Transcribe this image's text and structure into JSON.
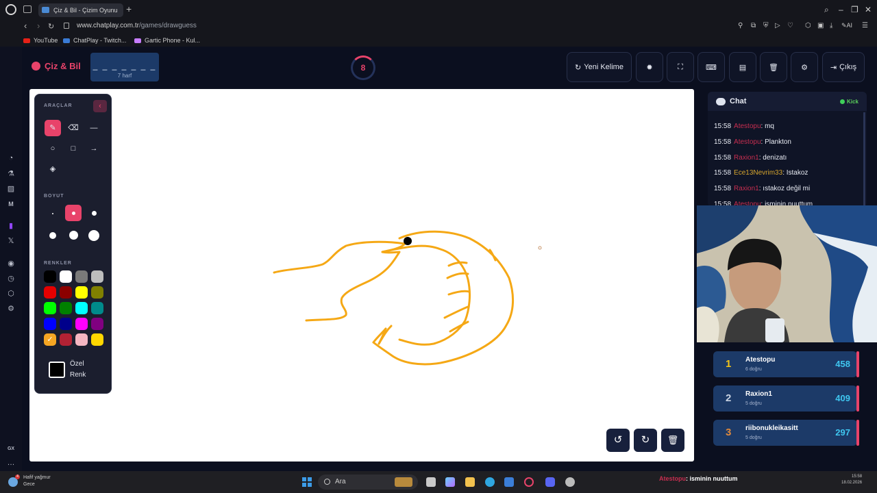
{
  "browser": {
    "tab_title": "Çiz & Bil - Çizim Oyunu",
    "url_host": "www.chatplay.com.tr",
    "url_path": "/games/drawguess",
    "bookmarks": [
      "YouTube",
      "ChatPlay - Twitch...",
      "Gartic Phone - Kul..."
    ]
  },
  "app": {
    "logo": "Çiz & Bil",
    "word_pattern": "_ _ _ _ _ _ _",
    "word_length": "7 harf",
    "timer": "8",
    "buttons": {
      "new_word": "Yeni Kelime",
      "exit": "Çıkış"
    }
  },
  "tools": {
    "tools_title": "ARAÇLAR",
    "size_title": "BOYUT",
    "colors_title": "RENKLER",
    "custom_color_label": "Özel Renk",
    "palette": [
      "#000000",
      "#ffffff",
      "#7a7a7a",
      "#bdbdbd",
      "#e60000",
      "#8b0000",
      "#ffff00",
      "#808000",
      "#00ff00",
      "#008000",
      "#00ffff",
      "#008b8b",
      "#0000ff",
      "#00008b",
      "#ff00ff",
      "#800080",
      "#f5a623",
      "#b22234",
      "#f4b6c2",
      "#ffd700"
    ],
    "selected_color": "#f5a623"
  },
  "chat": {
    "title": "Chat",
    "platform": "Kick",
    "messages": [
      {
        "time": "15:58",
        "user": "Atestopu",
        "text": "mq",
        "color": "red"
      },
      {
        "time": "15:58",
        "user": "Atestopu",
        "text": "Plankton",
        "color": "red"
      },
      {
        "time": "15:58",
        "user": "Raxion1",
        "text": "denizatı",
        "color": "red"
      },
      {
        "time": "15:58",
        "user": "Ece13Nevrim33",
        "text": "Istakoz",
        "color": "gold"
      },
      {
        "time": "15:58",
        "user": "Raxion1",
        "text": "ıstakoz değil mi",
        "color": "red"
      },
      {
        "time": "15:58",
        "user": "Atestopu",
        "text": "isminin nuuttum",
        "color": "red"
      }
    ]
  },
  "leaderboard": [
    {
      "rank": "1",
      "name": "Atestopu",
      "correct": "6 doğru",
      "score": "458",
      "rank_color": "#f5c518"
    },
    {
      "rank": "2",
      "name": "Raxion1",
      "correct": "5 doğru",
      "score": "409",
      "rank_color": "#c9d3e2"
    },
    {
      "rank": "3",
      "name": "riibonukleikasitt",
      "correct": "5 doğru",
      "score": "297",
      "rank_color": "#e08a3c"
    }
  ],
  "taskbar": {
    "weather": "Hafif yağmur",
    "weather_sub": "Gece",
    "search_placeholder": "Ara",
    "subtitle_user": "Atestopu",
    "subtitle_text": ": isminin nuuttum",
    "time": "15:58",
    "date": "18.02.2026"
  }
}
